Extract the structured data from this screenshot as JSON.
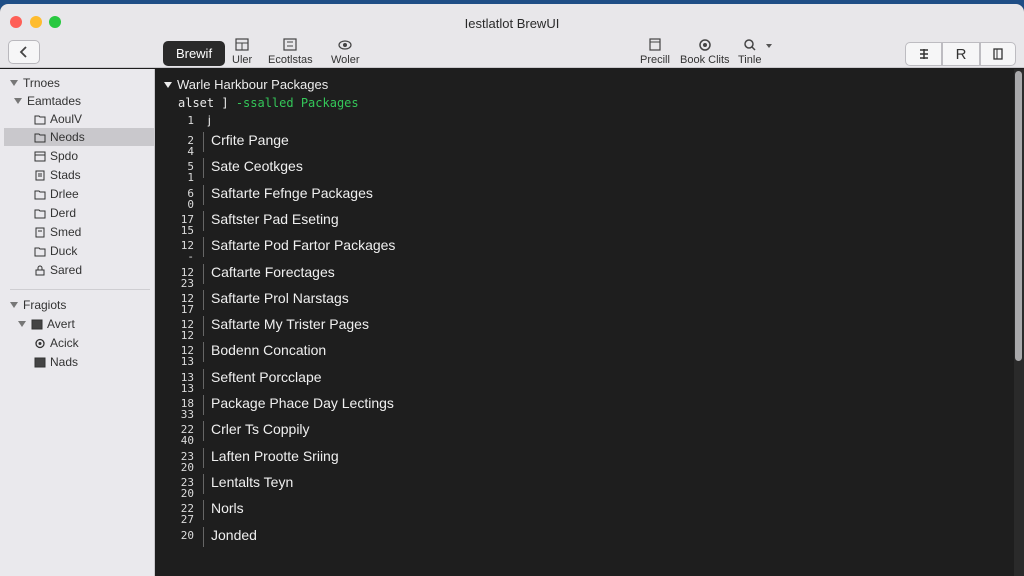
{
  "window": {
    "title": "Iestlatlot BrewUI"
  },
  "toolbar": {
    "browse_label": "Brewif",
    "tools": [
      {
        "label": "Uler",
        "icon": "grid-icon"
      },
      {
        "label": "Ecotlstas",
        "icon": "sliders-icon"
      },
      {
        "label": "Woler",
        "icon": "eye-icon"
      }
    ],
    "right_tools": [
      {
        "label": "Precill",
        "icon": "window-icon"
      },
      {
        "label": "Book Clits",
        "icon": "gear-icon"
      },
      {
        "label": "Tinle",
        "icon": "search-icon"
      }
    ],
    "segments": [
      {
        "label": "",
        "icon": "split-icon"
      },
      {
        "label": "R",
        "icon": ""
      },
      {
        "label": "",
        "icon": "panel-icon"
      }
    ]
  },
  "sidebar": {
    "section1": {
      "label": "Trnoes"
    },
    "group1": {
      "label": "Eamtades"
    },
    "items1": [
      {
        "label": "AoulV"
      },
      {
        "label": "Neods"
      },
      {
        "label": "Spdo"
      },
      {
        "label": "Stads"
      },
      {
        "label": "Drlee"
      },
      {
        "label": "Derd"
      },
      {
        "label": "Smed"
      },
      {
        "label": "Duck"
      },
      {
        "label": "Sared"
      }
    ],
    "section2": {
      "label": "Fragiots"
    },
    "group2": {
      "label": "Avert"
    },
    "items2": [
      {
        "label": "Acick"
      },
      {
        "label": "Nads"
      }
    ]
  },
  "content": {
    "header": "Warle Harkbour Packages",
    "code_line": {
      "prefix": "alset ]",
      "green": "-ssalled Packages"
    },
    "first_line_num": "1",
    "first_line_text": "j",
    "rows": [
      {
        "nums": [
          "2",
          "4"
        ],
        "text": "Crfite Pange"
      },
      {
        "nums": [
          "5",
          "1"
        ],
        "text": "Sate Ceotkges"
      },
      {
        "nums": [
          "6",
          "0"
        ],
        "text": "Saftarte Fefnge Packages"
      },
      {
        "nums": [
          "17",
          "15"
        ],
        "text": "Saftster Pad Eseting"
      },
      {
        "nums": [
          "12",
          "-"
        ],
        "text": "Saftarte Pod Fartor Packages"
      },
      {
        "nums": [
          "12",
          "23"
        ],
        "text": "Caftarte Forectages"
      },
      {
        "nums": [
          "12",
          "17"
        ],
        "text": "Saftarte Prol Narstags"
      },
      {
        "nums": [
          "12",
          "12"
        ],
        "text": "Saftarte My Trister Pages"
      },
      {
        "nums": [
          "12",
          "13"
        ],
        "text": "Bodenn Concation"
      },
      {
        "nums": [
          "13",
          "13"
        ],
        "text": "Seftent Porcclape"
      },
      {
        "nums": [
          "18",
          "33"
        ],
        "text": "Package Phace Day Lectings"
      },
      {
        "nums": [
          "22",
          "40"
        ],
        "text": "Crler Ts Coppily"
      },
      {
        "nums": [
          "23",
          "20"
        ],
        "text": "Laften Prootte Sriing"
      },
      {
        "nums": [
          "23",
          "20"
        ],
        "text": "Lentalts Teyn"
      },
      {
        "nums": [
          "22",
          "27"
        ],
        "text": "Norls"
      },
      {
        "nums": [
          "20",
          ""
        ],
        "text": "Jonded"
      }
    ]
  }
}
